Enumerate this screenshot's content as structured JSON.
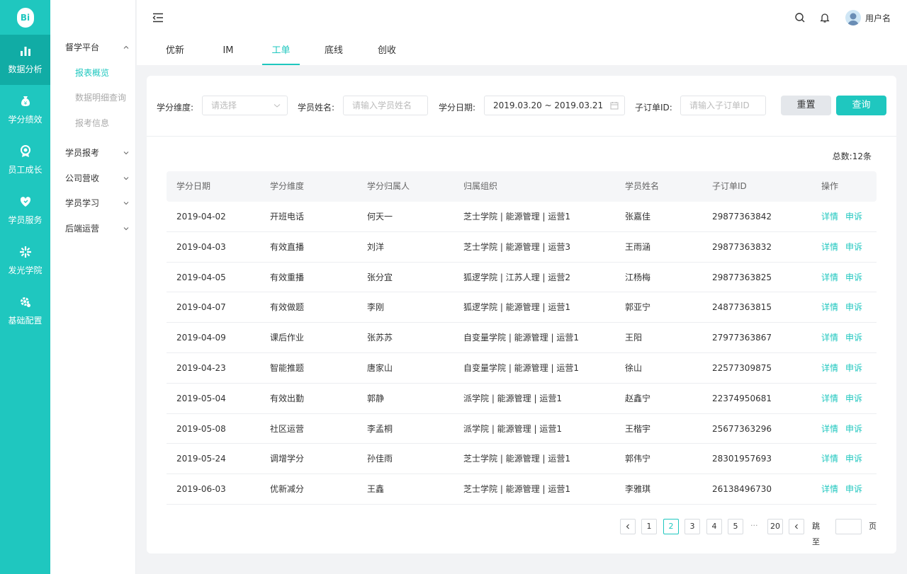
{
  "logo": {
    "text": "Bi"
  },
  "rail": [
    {
      "label": "数据分析",
      "icon": "bar-chart-icon",
      "active": true
    },
    {
      "label": "学分绩效",
      "icon": "money-bag-icon",
      "active": false
    },
    {
      "label": "员工成长",
      "icon": "badge-icon",
      "active": false
    },
    {
      "label": "学员服务",
      "icon": "heart-icon",
      "active": false
    },
    {
      "label": "发光学院",
      "icon": "sparkle-icon",
      "active": false
    },
    {
      "label": "基础配置",
      "icon": "gear-icon",
      "active": false
    }
  ],
  "submenu": {
    "groups": [
      {
        "label": "督学平台",
        "expanded": true
      },
      {
        "label": "学员报考",
        "expanded": false
      },
      {
        "label": "公司营收",
        "expanded": false
      },
      {
        "label": "学员学习",
        "expanded": false
      },
      {
        "label": "后端运营",
        "expanded": false
      }
    ],
    "subitems": [
      {
        "label": "报表概览",
        "active": true
      },
      {
        "label": "数据明细查询",
        "active": false
      },
      {
        "label": "报考信息",
        "active": false
      }
    ]
  },
  "header": {
    "username": "用户名",
    "tabs": [
      {
        "label": "优新",
        "active": false
      },
      {
        "label": "IM",
        "active": false
      },
      {
        "label": "工单",
        "active": true
      },
      {
        "label": "底线",
        "active": false
      },
      {
        "label": "创收",
        "active": false
      }
    ]
  },
  "filters": {
    "dimension_label": "学分维度:",
    "dimension_placeholder": "请选择",
    "student_label": "学员姓名:",
    "student_placeholder": "请输入学员姓名",
    "date_label": "学分日期:",
    "date_value": "2019.03.20 ~ 2019.03.21",
    "order_label": "子订单ID:",
    "order_placeholder": "请输入子订单ID",
    "reset_label": "重置",
    "query_label": "查询"
  },
  "total_text": "总数:12条",
  "table": {
    "columns": [
      "学分日期",
      "学分维度",
      "学分归属人",
      "归属组织",
      "学员姓名",
      "子订单ID",
      "操作"
    ],
    "action_detail": "详情",
    "action_appeal": "申诉",
    "rows": [
      [
        "2019-04-02",
        "开班电话",
        "何天一",
        "芝士学院 | 能源管理 | 运营1",
        "张嘉佳",
        "29877363842"
      ],
      [
        "2019-04-03",
        "有效直播",
        "刘洋",
        "芝士学院 | 能源管理 | 运营3",
        "王雨涵",
        "29877363832"
      ],
      [
        "2019-04-05",
        "有效重播",
        "张分宜",
        "狐逻学院 | 江苏人理 | 运营2",
        "江杨梅",
        "29877363825"
      ],
      [
        "2019-04-07",
        "有效做题",
        "李刚",
        "狐逻学院 | 能源管理 | 运营1",
        "郭亚宁",
        "24877363815"
      ],
      [
        "2019-04-09",
        "课后作业",
        "张苏苏",
        "自变量学院 | 能源管理 | 运营1",
        "王阳",
        "27977363867"
      ],
      [
        "2019-04-23",
        "智能推题",
        "唐家山",
        "自变量学院 | 能源管理 | 运营1",
        "徐山",
        "22577309875"
      ],
      [
        "2019-05-04",
        "有效出勤",
        "郭静",
        "派学院 | 能源管理 | 运营1",
        "赵鑫宁",
        "22374950681"
      ],
      [
        "2019-05-08",
        "社区运营",
        "李孟桐",
        "派学院 | 能源管理 | 运营1",
        "王楷宇",
        "25677363296"
      ],
      [
        "2019-05-24",
        "调增学分",
        "孙佳雨",
        "芝士学院 | 能源管理 | 运营1",
        "郭伟宁",
        "28301957693"
      ],
      [
        "2019-06-03",
        "优新减分",
        "王鑫",
        "芝士学院 | 能源管理 | 运营1",
        "李雅琪",
        "26138496730"
      ]
    ]
  },
  "pagination": {
    "pages": [
      "1",
      "2",
      "3",
      "4",
      "5"
    ],
    "current": "2",
    "ellipsis": "···",
    "last": "20",
    "jump_label": "跳至",
    "page_suffix": "页"
  },
  "colors": {
    "accent": "#1fc7bf",
    "accent_dark": "#11aca5"
  }
}
